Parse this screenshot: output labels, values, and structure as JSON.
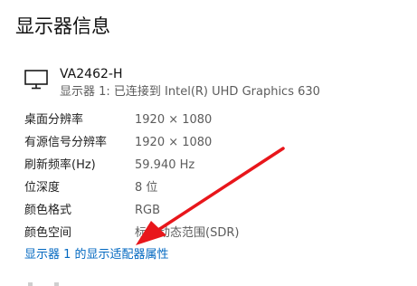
{
  "page": {
    "title": "显示器信息"
  },
  "monitor": {
    "icon": "monitor-icon",
    "name": "VA2462-H",
    "description": "显示器 1: 已连接到 Intel(R) UHD Graphics 630"
  },
  "info_rows": [
    {
      "label": "桌面分辨率",
      "value": "1920 × 1080"
    },
    {
      "label": "有源信号分辨率",
      "value": "1920 × 1080"
    },
    {
      "label": "刷新频率(Hz)",
      "value": "59.940 Hz"
    },
    {
      "label": "位深度",
      "value": "8 位"
    },
    {
      "label": "颜色格式",
      "value": "RGB"
    },
    {
      "label": "颜色空间",
      "value": "标准动态范围(SDR)"
    }
  ],
  "adapter_link": {
    "label": "显示器 1 的显示适配器属性"
  },
  "annotation": {
    "arrow_color": "#e8161b"
  },
  "colors": {
    "link": "#0067c0",
    "secondary_text": "#5c5c5c"
  }
}
